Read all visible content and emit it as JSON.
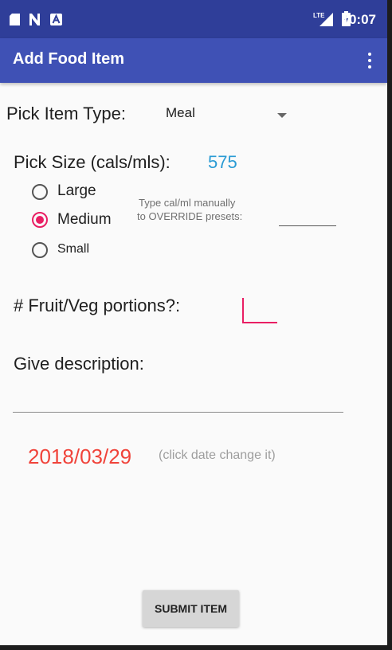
{
  "status_bar": {
    "time": "10:07",
    "icons": [
      "sd-card-icon",
      "n-icon",
      "a-icon",
      "lte-signal-icon",
      "battery-icon"
    ]
  },
  "app_bar": {
    "title": "Add Food Item"
  },
  "form": {
    "item_type_label": "Pick Item Type:",
    "item_type_value": "Meal",
    "size_label": "Pick Size (cals/mls):",
    "size_value": "575",
    "size_options": [
      {
        "label": "Large",
        "selected": false
      },
      {
        "label": "Medium",
        "selected": true
      },
      {
        "label": "Small",
        "selected": false
      }
    ],
    "override_hint_line1": "Type cal/ml manually",
    "override_hint_line2": "to OVERRIDE presets:",
    "override_value": "",
    "fruit_veg_label": "# Fruit/Veg portions?:",
    "fruit_veg_value": "",
    "description_label": "Give description:",
    "description_value": "",
    "date_value": "2018/03/29",
    "date_hint": "(click date change it)",
    "submit_label": "SUBMIT ITEM"
  },
  "colors": {
    "status_bar": "#2f3e99",
    "app_bar": "#3f51b5",
    "accent": "#e91e63",
    "size_value": "#2a9bd4",
    "date": "#f0433a"
  }
}
